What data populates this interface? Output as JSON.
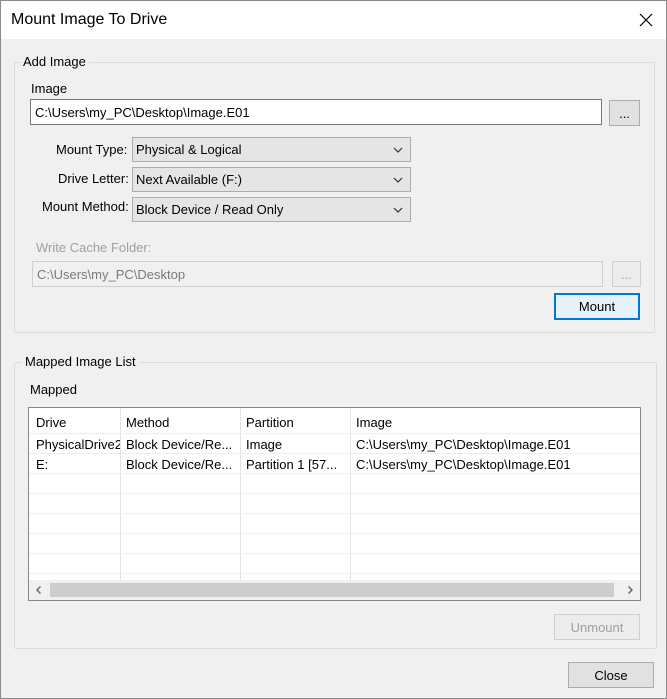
{
  "window": {
    "title": "Mount Image To Drive"
  },
  "add_image": {
    "legend": "Add Image",
    "image_label": "Image",
    "image_path": "C:\\Users\\my_PC\\Desktop\\Image.E01",
    "browse_label": "...",
    "mount_type_label": "Mount Type:",
    "mount_type_value": "Physical & Logical",
    "drive_letter_label": "Drive Letter:",
    "drive_letter_value": "Next Available (F:)",
    "mount_method_label": "Mount Method:",
    "mount_method_value": "Block Device / Read Only",
    "cache_label": "Write Cache Folder:",
    "cache_path": "C:\\Users\\my_PC\\Desktop",
    "cache_browse_label": "...",
    "mount_button": "Mount"
  },
  "mapped": {
    "legend": "Mapped Image List",
    "list_label": "Mapped",
    "columns": [
      "Drive",
      "Method",
      "Partition",
      "Image"
    ],
    "rows": [
      [
        "PhysicalDrive2",
        "Block Device/Re...",
        "Image",
        "C:\\Users\\my_PC\\Desktop\\Image.E01"
      ],
      [
        "E:",
        "Block Device/Re...",
        "Partition 1 [57...",
        "C:\\Users\\my_PC\\Desktop\\Image.E01"
      ]
    ],
    "unmount_button": "Unmount"
  },
  "footer": {
    "close_button": "Close"
  },
  "icons": {
    "close": "close-icon",
    "dropdown": "chevron-down-icon",
    "scroll_left": "chevron-left-icon",
    "scroll_right": "chevron-right-icon"
  },
  "colors": {
    "accent": "#0078d7",
    "disabled_text": "#a0a0a0"
  }
}
